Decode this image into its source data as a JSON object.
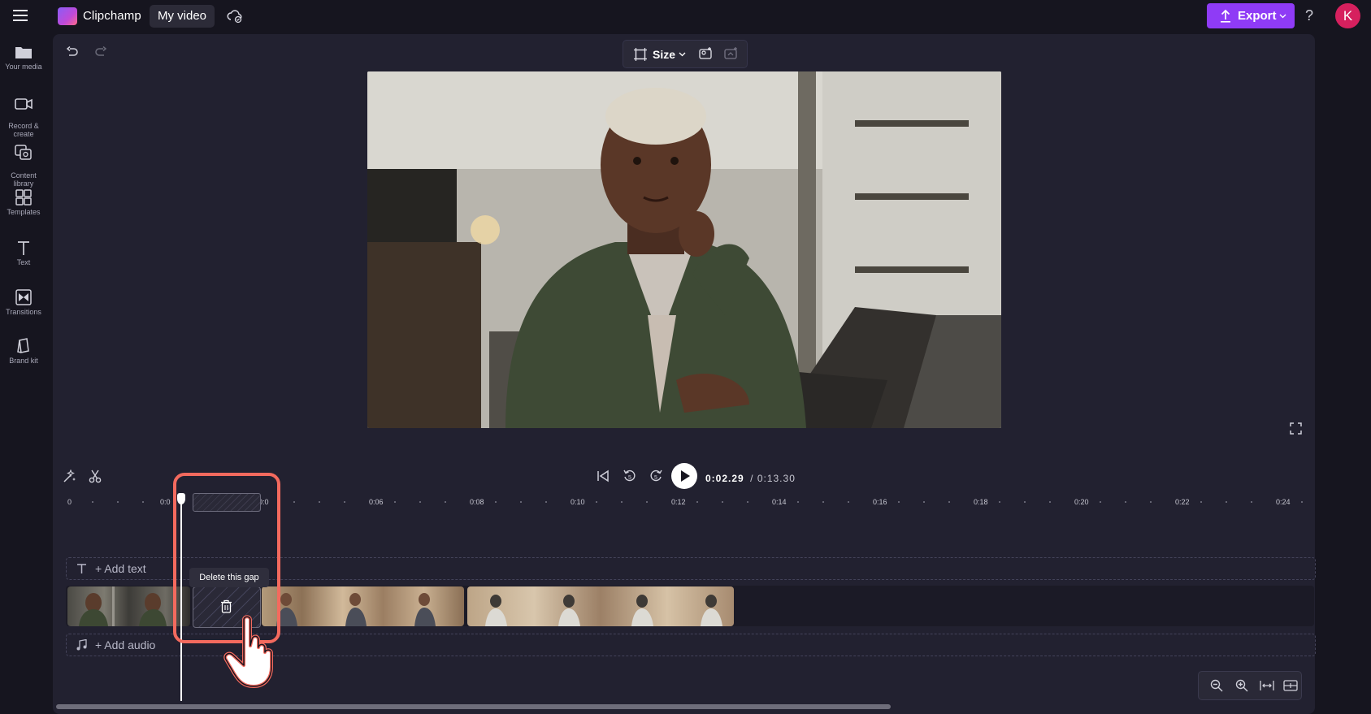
{
  "app": {
    "name": "Clipchamp",
    "project_title": "My video"
  },
  "header": {
    "export_label": "Export",
    "help_label": "?",
    "avatar_initial": "K"
  },
  "sidebar": {
    "items": [
      {
        "icon": "folder-icon",
        "label": "Your media"
      },
      {
        "icon": "camera-icon",
        "label": "Record &\ncreate"
      },
      {
        "icon": "library-icon",
        "label": "Content\nlibrary"
      },
      {
        "icon": "templates-icon",
        "label": "Templates"
      },
      {
        "icon": "text-icon",
        "label": "Text"
      },
      {
        "icon": "transitions-icon",
        "label": "Transitions"
      },
      {
        "icon": "brand-kit-icon",
        "label": "Brand kit"
      }
    ]
  },
  "preview": {
    "size_label": "Size"
  },
  "playback": {
    "current_time": "0:02.29",
    "total_time": "/ 0:13.30"
  },
  "ruler": {
    "labels": [
      "0",
      "0:0",
      "0:0",
      "0:06",
      "0:08",
      "0:10",
      "0:12",
      "0:14",
      "0:16",
      "0:18",
      "0:20",
      "0:22",
      "0:24"
    ]
  },
  "tracks": {
    "text_track_label": "+ Add text",
    "audio_track_label": "+ Add audio",
    "gap_tooltip": "Delete this gap"
  },
  "colors": {
    "accent": "#8f3bf6",
    "highlight": "#f36a5e",
    "avatar": "#d6205e"
  }
}
